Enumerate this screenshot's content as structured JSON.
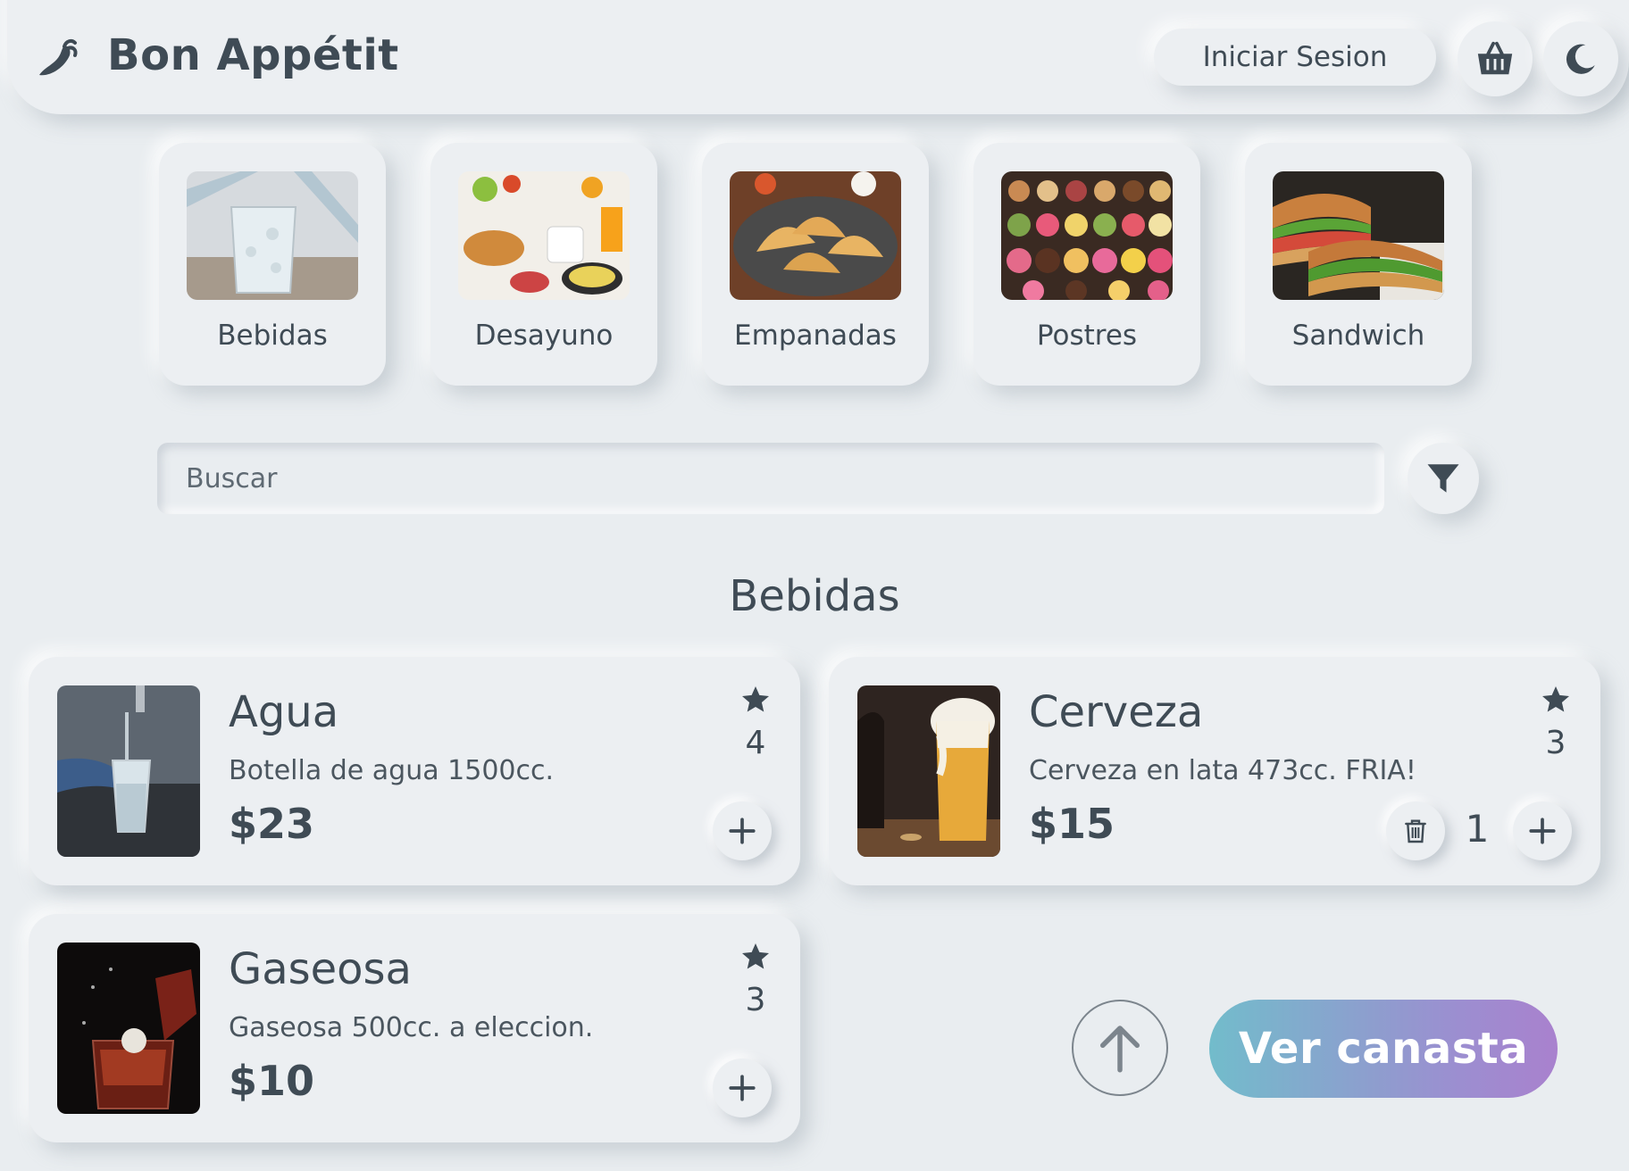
{
  "header": {
    "brand": "Bon Appétit",
    "logo_icon": "chili-pepper-icon",
    "login_label": "Iniciar Sesion",
    "basket_icon": "basket-icon",
    "theme_icon": "moon-icon"
  },
  "categories": [
    {
      "label": "Bebidas",
      "image": "glass-of-sparkling-water"
    },
    {
      "label": "Desayuno",
      "image": "breakfast-spread"
    },
    {
      "label": "Empanadas",
      "image": "empanadas-plate"
    },
    {
      "label": "Postres",
      "image": "assorted-pastries"
    },
    {
      "label": "Sandwich",
      "image": "sub-sandwiches"
    }
  ],
  "search": {
    "placeholder": "Buscar",
    "value": "",
    "filter_icon": "filter-icon"
  },
  "section_title": "Bebidas",
  "products": [
    {
      "name": "Agua",
      "description": "Botella de agua 1500cc.",
      "price": "$23",
      "rating": "4",
      "quantity": null
    },
    {
      "name": "Cerveza",
      "description": "Cerveza en lata 473cc. FRIA!",
      "price": "$15",
      "rating": "3",
      "quantity": "1"
    },
    {
      "name": "Gaseosa",
      "description": "Gaseosa 500cc. a eleccion.",
      "price": "$10",
      "rating": "3",
      "quantity": null
    }
  ],
  "actions": {
    "scroll_top_icon": "arrow-up-icon",
    "basket_button": "Ver canasta"
  },
  "colors": {
    "text": "#3f4b55",
    "background": "#e9edf0",
    "gradient_start": "#72bccb",
    "gradient_end": "#a981ce"
  }
}
